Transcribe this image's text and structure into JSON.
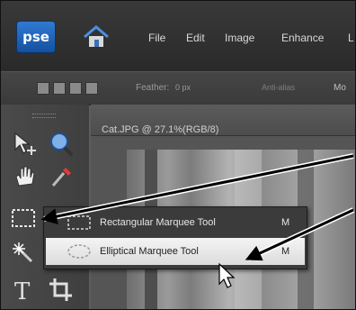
{
  "app": {
    "logo_text": "pse",
    "menu": [
      "File",
      "Edit",
      "Image",
      "Enhance",
      "L"
    ],
    "home_icon": "home-icon"
  },
  "options_bar": {
    "feather_label": "Feather:",
    "feather_value": "0 px",
    "antialias_label": "Anti-alias",
    "mode_label": "Mo"
  },
  "document": {
    "title": "Cat.JPG @ 27.1%(RGB/8)"
  },
  "flyout": {
    "items": [
      {
        "label": "Rectangular Marquee Tool",
        "shortcut": "M",
        "icon": "rectangular-marquee-icon"
      },
      {
        "label": "Elliptical Marquee Tool",
        "shortcut": "M",
        "icon": "elliptical-marquee-icon",
        "highlighted": true
      }
    ]
  },
  "colors": {
    "menubar": "#2e2e2e",
    "logo_blue": "#1f62b8",
    "flyout_bg": "#3b3b3b",
    "highlight": "#e8e8e8"
  }
}
